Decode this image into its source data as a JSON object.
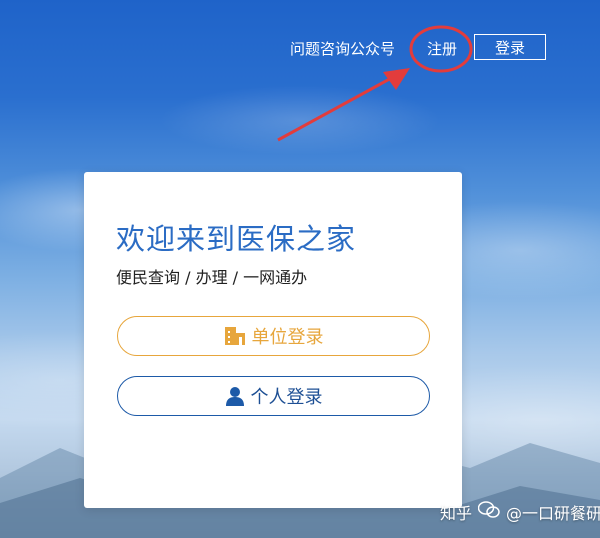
{
  "header": {
    "consult_label": "问题咨询公众号",
    "register_label": "注册",
    "login_label": "登录"
  },
  "card": {
    "title": "欢迎来到医保之家",
    "subtitle": "便民查询 / 办理 / 一网通办",
    "unit_login_label": "单位登录",
    "personal_login_label": "个人登录"
  },
  "watermark": {
    "platform": "知乎",
    "author": "@一口研餐研"
  },
  "colors": {
    "accent_blue": "#2b6cc4",
    "unit_orange": "#e7a63c",
    "personal_blue": "#1d4f94",
    "annotation_red": "#e23c3c"
  },
  "icons": {
    "unit_login": "building-icon",
    "personal_login": "person-icon"
  }
}
